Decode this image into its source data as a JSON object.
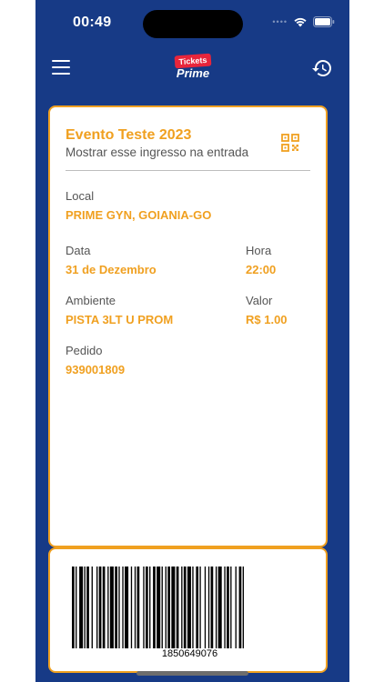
{
  "status_bar": {
    "time": "00:49"
  },
  "nav": {
    "logo_tag": "Tickets",
    "logo_word": "Prime"
  },
  "ticket": {
    "event_title": "Evento Teste 2023",
    "event_subtitle": "Mostrar esse ingresso na entrada",
    "fields": {
      "local_label": "Local",
      "local_value": "PRIME GYN, GOIANIA-GO",
      "data_label": "Data",
      "data_value": "31 de Dezembro",
      "hora_label": "Hora",
      "hora_value": "22:00",
      "ambiente_label": "Ambiente",
      "ambiente_value": "PISTA 3LT U PROM",
      "valor_label": "Valor",
      "valor_value": "R$ 1.00",
      "pedido_label": "Pedido",
      "pedido_value": "939001809"
    },
    "barcode_number": "1850649076"
  },
  "colors": {
    "background": "#173a86",
    "accent": "#f0a020",
    "logo_red": "#e8253b"
  },
  "icons": [
    "menu-icon",
    "history-icon",
    "qr-code-icon",
    "wifi-icon",
    "battery-icon"
  ]
}
